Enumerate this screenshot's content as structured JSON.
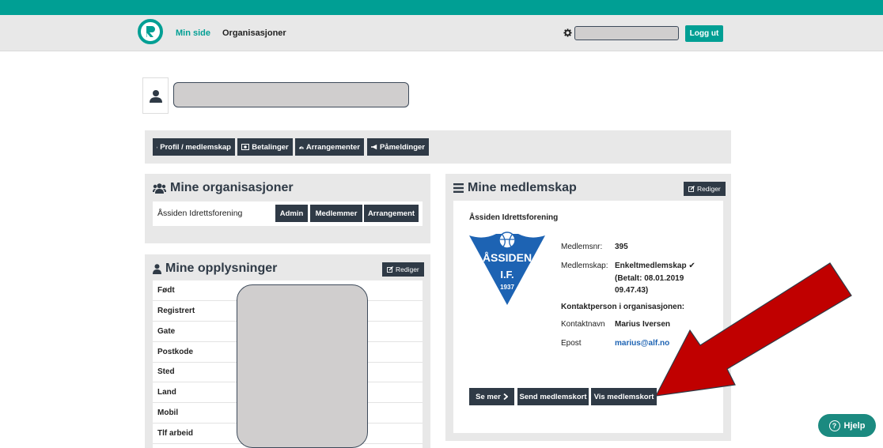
{
  "nav": {
    "links": [
      "Min side",
      "Organisasjoner"
    ],
    "logout_label": "Logg ut"
  },
  "tabs": [
    {
      "label": "Profil / medlemskap",
      "icon": "user-icon"
    },
    {
      "label": "Betalinger",
      "icon": "money-icon"
    },
    {
      "label": "Arrangementer",
      "icon": "dashboard-icon"
    },
    {
      "label": "Påmeldinger",
      "icon": "bullhorn-icon"
    }
  ],
  "organisations": {
    "title": "Mine organisasjoner",
    "rows": [
      {
        "name": "Åssiden Idrettsforening",
        "buttons": [
          "Admin",
          "Medlemmer",
          "Arrangement"
        ]
      }
    ]
  },
  "personal": {
    "title": "Mine opplysninger",
    "edit_label": "Rediger",
    "fields": [
      "Født",
      "Registrert",
      "Gate",
      "Postkode",
      "Sted",
      "Land",
      "Mobil",
      "Tlf arbeid"
    ]
  },
  "membership": {
    "title": "Mine medlemskap",
    "edit_label": "Rediger",
    "org_name": "Åssiden Idrettsforening",
    "logo": {
      "top": "ÅSSIDEN",
      "mid": "I.F.",
      "year": "1937",
      "color": "#1d63b3"
    },
    "member_no_label": "Medlemsnr:",
    "member_no": "395",
    "membership_label": "Medlemskap:",
    "membership_type": "Enkeltmedlemskap ✔",
    "paid_line1": "(Betalt: 08.01.2019",
    "paid_line2": "09.47.43)",
    "contact_heading": "Kontaktperson i organisasjonen:",
    "contact_name_label": "Kontaktnavn",
    "contact_name": "Marius Iversen",
    "email_label": "Epost",
    "email": "marius@alf.no",
    "buttons": {
      "more": "Se mer",
      "send": "Send medlemskort",
      "show": "Vis medlemskort"
    }
  },
  "help_label": "Hjelp",
  "colors": {
    "accent": "#009f94",
    "dark": "#2f3a46",
    "arrow": "#c00000",
    "redacted": "#d0cece"
  }
}
